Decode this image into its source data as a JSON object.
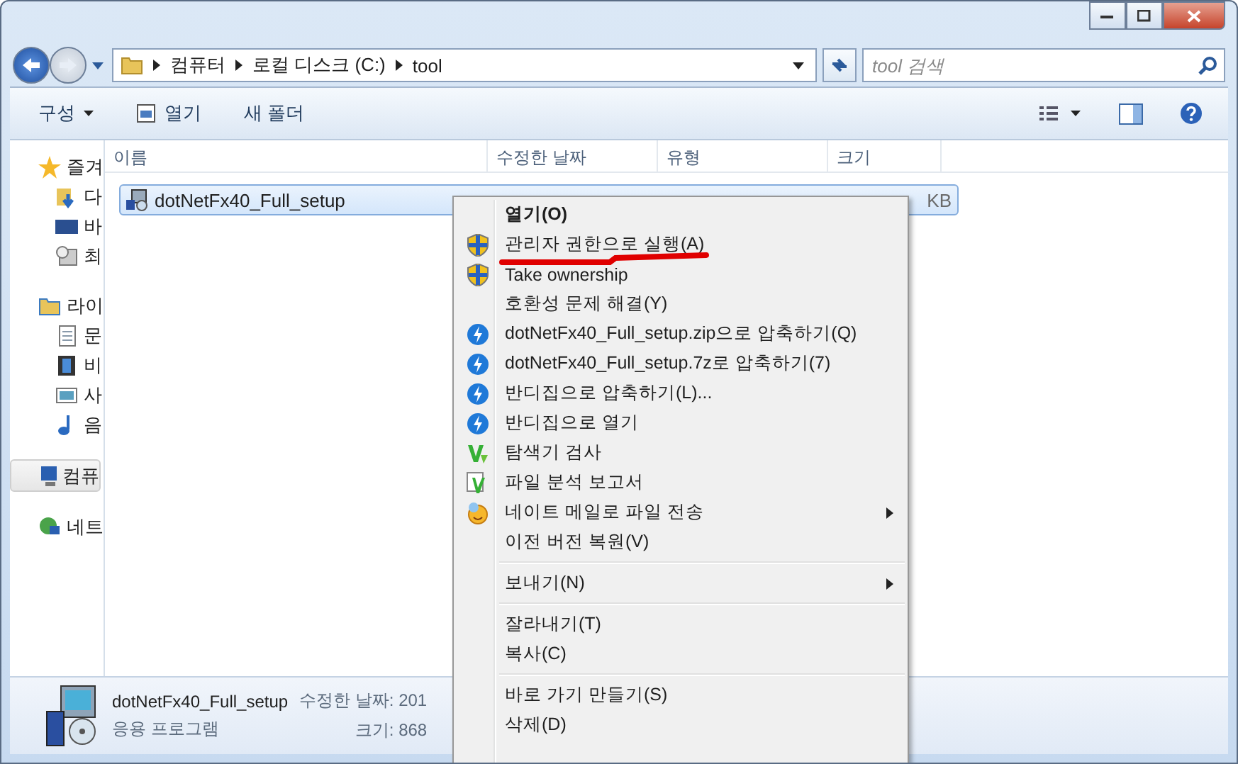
{
  "address": {
    "crumbs": [
      "컴퓨터",
      "로컬 디스크 (C:)",
      "tool"
    ]
  },
  "search": {
    "placeholder": "tool 검색"
  },
  "toolbar": {
    "organize": "구성",
    "open": "열기",
    "new_folder": "새 폴더"
  },
  "sidebar": {
    "groups": [
      {
        "label": "즐겨",
        "children": [
          {
            "label": "다"
          },
          {
            "label": "바"
          },
          {
            "label": "최"
          }
        ]
      },
      {
        "label": "라이",
        "children": [
          {
            "label": "문"
          },
          {
            "label": "비"
          },
          {
            "label": "사"
          },
          {
            "label": "음"
          }
        ]
      },
      {
        "label": "컴퓨",
        "selected": true
      },
      {
        "label": "네트",
        "selected": false
      }
    ]
  },
  "table": {
    "columns": [
      "이름",
      "수정한 날짜",
      "유형",
      "크기"
    ],
    "rows": [
      {
        "name": "dotNetFx40_Full_setup",
        "size": "KB",
        "selected": true
      }
    ]
  },
  "context_menu": {
    "groups": [
      [
        {
          "label": "열기(O)",
          "kind": "plain",
          "default": true,
          "submenu": false
        },
        {
          "label": "관리자 권한으로 실행(A)",
          "kind": "shield",
          "default": false,
          "submenu": false
        },
        {
          "label": "Take ownership",
          "kind": "shield",
          "default": false,
          "submenu": false
        },
        {
          "label": "호환성 문제 해결(Y)",
          "kind": "plain",
          "default": false,
          "submenu": false
        },
        {
          "label": "dotNetFx40_Full_setup.zip으로 압축하기(Q)",
          "kind": "bandizip",
          "default": false,
          "submenu": false
        },
        {
          "label": "dotNetFx40_Full_setup.7z로 압축하기(7)",
          "kind": "bandizip",
          "default": false,
          "submenu": false
        },
        {
          "label": "반디집으로 압축하기(L)...",
          "kind": "bandizip",
          "default": false,
          "submenu": false
        },
        {
          "label": "반디집으로 열기",
          "kind": "bandizip",
          "default": false,
          "submenu": false
        },
        {
          "label": "탐색기 검사",
          "kind": "v3",
          "default": false,
          "submenu": false
        },
        {
          "label": "파일 분석 보고서",
          "kind": "v3report",
          "default": false,
          "submenu": false
        },
        {
          "label": "네이트 메일로 파일 전송",
          "kind": "nate",
          "default": false,
          "submenu": true
        },
        {
          "label": "이전 버전 복원(V)",
          "kind": "plain",
          "default": false,
          "submenu": false
        }
      ],
      [
        {
          "label": "보내기(N)",
          "kind": "plain",
          "default": false,
          "submenu": true
        }
      ],
      [
        {
          "label": "잘라내기(T)",
          "kind": "plain",
          "default": false,
          "submenu": false
        },
        {
          "label": "복사(C)",
          "kind": "plain",
          "default": false,
          "submenu": false
        }
      ],
      [
        {
          "label": "바로 가기 만들기(S)",
          "kind": "plain",
          "default": false,
          "submenu": false
        },
        {
          "label": "삭제(D)",
          "kind": "plain",
          "default": false,
          "submenu": false
        }
      ]
    ]
  },
  "details": {
    "name": "dotNetFx40_Full_setup",
    "type": "응용 프로그램",
    "modified_label": "수정한 날짜: 201",
    "size_label": "크기: 868"
  }
}
